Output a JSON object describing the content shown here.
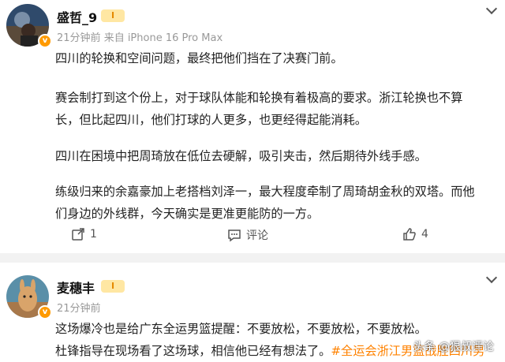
{
  "post1": {
    "username": "盛哲_9",
    "level": "Ⅰ",
    "time": "21分钟前",
    "source": "来自 iPhone 16 Pro Max",
    "paragraphs": [
      "四川的轮换和空间问题，最终把他们挡在了决赛门前。",
      "赛会制打到这个份上，对于球队体能和轮换有着极高的要求。浙江轮换也不算长，但比起四川，他们打球的人更多，也更经得起能消耗。",
      "四川在困境中把周琦放在低位去硬解，吸引夹击，然后期待外线手感。",
      "练级归来的余嘉豪加上老搭档刘泽一，最大程度牵制了周琦胡金秋的双塔。而他们身边的外线群，今天确实是更准更能防的一方。"
    ],
    "actions": {
      "repost_count": "1",
      "comment_label": "评论",
      "like_count": "4"
    }
  },
  "post2": {
    "username": "麦穗丰",
    "level": "Ⅰ",
    "time": "21分钟前",
    "line1": "这场爆冷也是给广东全运男篮提醒：不要放松，不要放松，不要放松。",
    "line2": "杜锋指导在现场看了这场球，相信他已经有想法了。",
    "hashtag": "#全运会浙江男篮战胜四川男"
  },
  "watermark": "头条 @狠叔评论",
  "colors": {
    "accent": "#ff8200",
    "meta": "#999999",
    "badge": "#ff9a00"
  }
}
